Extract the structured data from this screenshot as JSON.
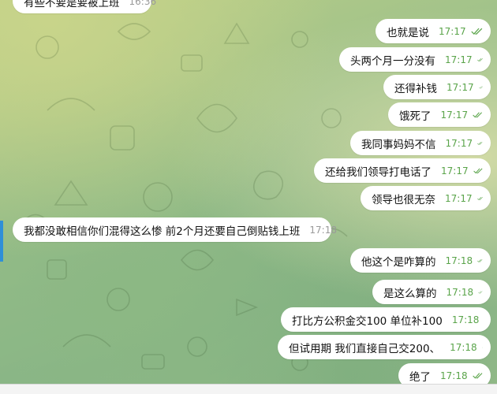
{
  "messages": [
    {
      "text": "有些不要是要被上班",
      "time": "16:36",
      "dir": "in"
    },
    {
      "text": "也就是说",
      "time": "17:17",
      "dir": "out"
    },
    {
      "text": "头两个月一分没有",
      "time": "17:17",
      "dir": "out"
    },
    {
      "text": "还得补钱",
      "time": "17:17",
      "dir": "out"
    },
    {
      "text": "饿死了",
      "time": "17:17",
      "dir": "out"
    },
    {
      "text": "我同事妈妈不信",
      "time": "17:17",
      "dir": "out"
    },
    {
      "text": "还给我们领导打电话了",
      "time": "17:17",
      "dir": "out"
    },
    {
      "text": "领导也很无奈",
      "time": "17:17",
      "dir": "out"
    },
    {
      "text": "我都没敢相信你们混得这么惨  前2个月还要自己倒贴钱上班",
      "time": "17:18",
      "dir": "in"
    },
    {
      "text": "他这个是咋算的",
      "time": "17:18",
      "dir": "out"
    },
    {
      "text": "是这么算的",
      "time": "17:18",
      "dir": "out"
    },
    {
      "text": "打比方公积金交100 单位补100",
      "time": "17:18",
      "dir": "out"
    },
    {
      "text": "但试用期 我们直接自己交200、",
      "time": "17:18",
      "dir": "out"
    },
    {
      "text": "绝了",
      "time": "17:18",
      "dir": "out"
    }
  ],
  "read_icon": "double-check-icon",
  "colors": {
    "bubble": "#ffffff",
    "tick": "#5aa44a",
    "time_out": "#5aa44a",
    "time_in": "#9a9a9a"
  }
}
